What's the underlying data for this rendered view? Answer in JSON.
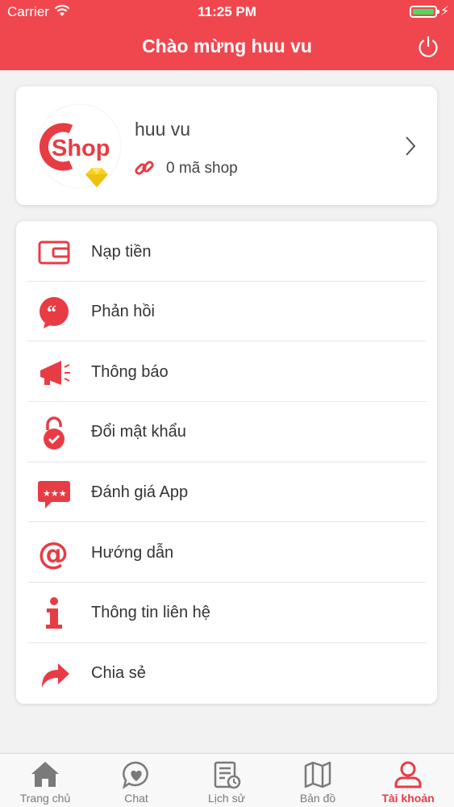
{
  "status": {
    "carrier": "Carrier",
    "time": "11:25 PM"
  },
  "header": {
    "title": "Chào mừng huu vu"
  },
  "profile": {
    "name": "huu vu",
    "shop_count": "0 mã shop",
    "logo_text": "Shop"
  },
  "menu": [
    {
      "label": "Nạp tiền",
      "icon": "wallet-icon"
    },
    {
      "label": "Phản hồi",
      "icon": "feedback-icon"
    },
    {
      "label": "Thông báo",
      "icon": "megaphone-icon"
    },
    {
      "label": "Đổi mật khẩu",
      "icon": "lock-icon"
    },
    {
      "label": "Đánh giá App",
      "icon": "rating-icon"
    },
    {
      "label": "Hướng dẫn",
      "icon": "at-icon"
    },
    {
      "label": "Thông tin liên hệ",
      "icon": "info-icon"
    },
    {
      "label": "Chia sẻ",
      "icon": "share-icon"
    }
  ],
  "tabs": [
    {
      "label": "Trang chủ",
      "icon": "home-icon",
      "active": false
    },
    {
      "label": "Chat",
      "icon": "chat-icon",
      "active": false
    },
    {
      "label": "Lịch sử",
      "icon": "history-icon",
      "active": false
    },
    {
      "label": "Bản đồ",
      "icon": "map-icon",
      "active": false
    },
    {
      "label": "Tài khoản",
      "icon": "user-icon",
      "active": true
    }
  ],
  "colors": {
    "accent": "#f0474f",
    "icon_red": "#e83c45",
    "gem": "#f7d21b",
    "battery": "#4cd964"
  }
}
